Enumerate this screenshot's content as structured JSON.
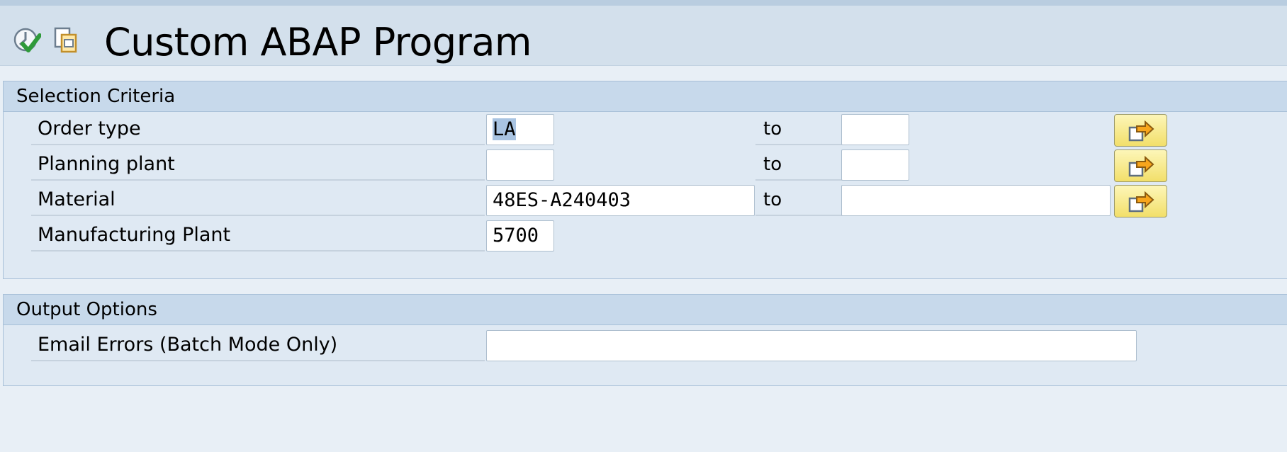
{
  "window": {
    "title": "Custom ABAP Program",
    "toolbar_icons": [
      "execute-icon",
      "get-variant-icon"
    ]
  },
  "selection_criteria": {
    "heading": "Selection Criteria",
    "range_label": "to",
    "rows": [
      {
        "label": "Order type",
        "low": "LA",
        "high": "",
        "has_multiple_selection": true
      },
      {
        "label": "Planning plant",
        "low": "",
        "high": "",
        "has_multiple_selection": true
      },
      {
        "label": "Material",
        "low": "48ES-A240403",
        "high": "",
        "has_multiple_selection": true
      },
      {
        "label": "Manufacturing Plant",
        "low": "5700"
      }
    ],
    "multiple_selection_icon": "multiple-selection-arrow-icon"
  },
  "output_options": {
    "heading": "Output Options",
    "rows": [
      {
        "label": "Email Errors (Batch Mode Only)",
        "value": ""
      }
    ]
  },
  "colors": {
    "background": "#e8eff6",
    "group_header": "#c7d9eb",
    "selected_text": "#a9c4e2",
    "multi_sel_button": "#f2df6a"
  }
}
